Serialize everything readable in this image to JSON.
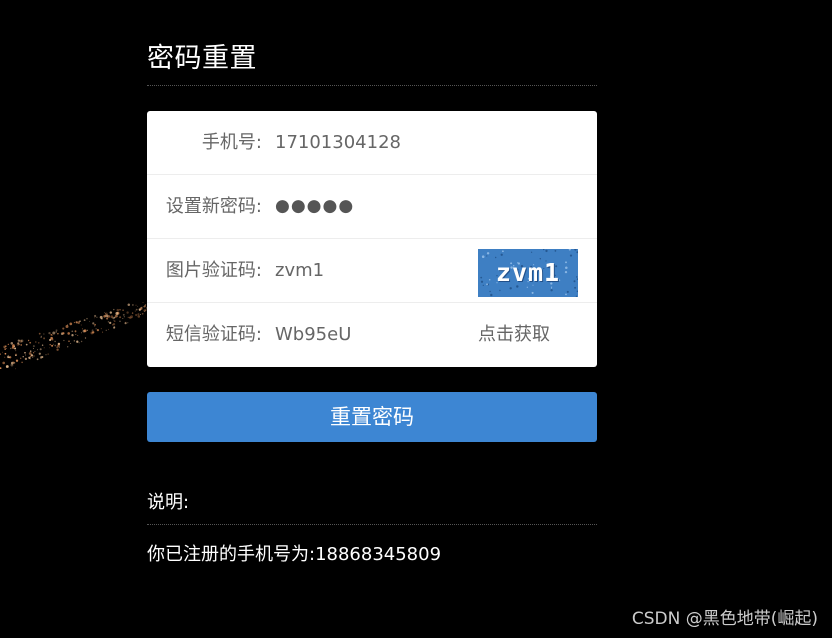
{
  "page": {
    "title": "密码重置"
  },
  "form": {
    "phone": {
      "label": "手机号:",
      "value": "17101304128"
    },
    "new_password": {
      "label": "设置新密码:",
      "value": "●●●●●"
    },
    "image_captcha": {
      "label": "图片验证码:",
      "value": "zvm1",
      "captcha_text": "zvm1"
    },
    "sms_code": {
      "label": "短信验证码:",
      "value": "Wb95eU",
      "action_label": "点击获取"
    }
  },
  "submit": {
    "label": "重置密码"
  },
  "notes": {
    "title": "说明:",
    "text": "你已注册的手机号为:18868345809"
  },
  "watermark": {
    "text": "CSDN @黑色地带(崛起)"
  },
  "colors": {
    "background": "#000000",
    "card": "#ffffff",
    "button": "#3d86d3",
    "captcha_bg": "#3e7fc3",
    "label_text": "#666666"
  }
}
